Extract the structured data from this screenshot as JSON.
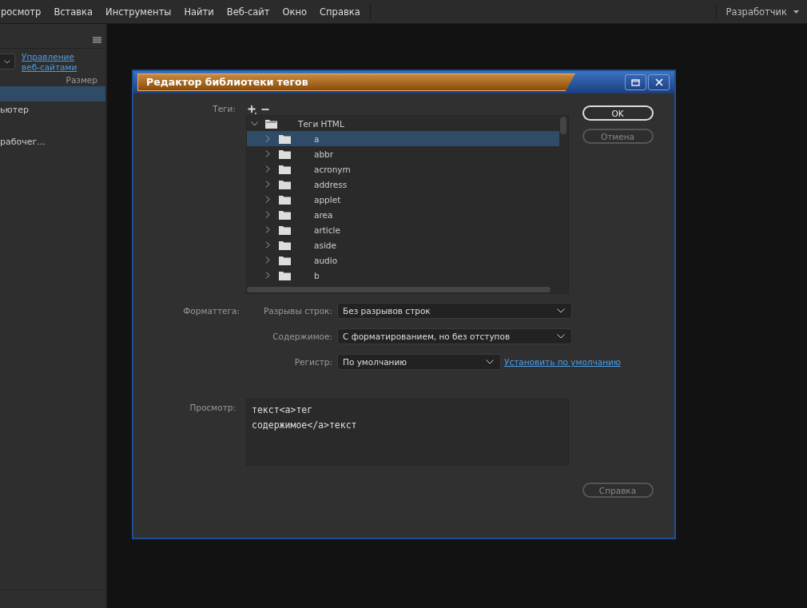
{
  "menu": [
    "росмотр",
    "Вставка",
    "Инструменты",
    "Найти",
    "Веб-сайт",
    "Окно",
    "Справка"
  ],
  "workspace": {
    "label": "Разработчик"
  },
  "left_panel": {
    "manage_link_lines": [
      "Управление",
      "веб-сайтами"
    ],
    "column": "Размер",
    "rows": [
      {
        "selected": true
      },
      {
        "text": "ьютер",
        "selected": false
      },
      {
        "text": "рабочег...",
        "selected": false
      }
    ]
  },
  "dialog": {
    "title": "Редактор библиотеки тегов",
    "tags_label": "Теги:",
    "tree": {
      "label": "Теги HTML",
      "expanded": true,
      "children": [
        {
          "label": "a",
          "selected": true,
          "expanded": false
        },
        {
          "label": "abbr",
          "selected": false,
          "expanded": false
        },
        {
          "label": "acronym",
          "selected": false,
          "expanded": false
        },
        {
          "label": "address",
          "selected": false,
          "expanded": false
        },
        {
          "label": "applet",
          "selected": false,
          "expanded": false
        },
        {
          "label": "area",
          "selected": false,
          "expanded": false
        },
        {
          "label": "article",
          "selected": false,
          "expanded": false
        },
        {
          "label": "aside",
          "selected": false,
          "expanded": false
        },
        {
          "label": "audio",
          "selected": false,
          "expanded": false
        },
        {
          "label": "b",
          "selected": false,
          "expanded": false
        }
      ]
    },
    "format_label": "Форматтега:",
    "fields": [
      {
        "label": "Разрывы строк:",
        "value": "Без разрывов строк",
        "kind": "wide"
      },
      {
        "label": "Содержимое:",
        "value": "С форматированием, но без отступов",
        "kind": "wide"
      },
      {
        "label": "Регистр:",
        "value": "По умолчанию",
        "kind": "narrow",
        "link": "Установить по умолчанию"
      }
    ],
    "preview_label": "Просмотр:",
    "preview_lines": [
      "текст<a>тег",
      "содержимое</a>текст"
    ],
    "buttons": [
      {
        "label": "OK",
        "kind": "primary"
      },
      {
        "label": "Отмена",
        "kind": "secondary"
      }
    ],
    "help_button": "Справка"
  }
}
